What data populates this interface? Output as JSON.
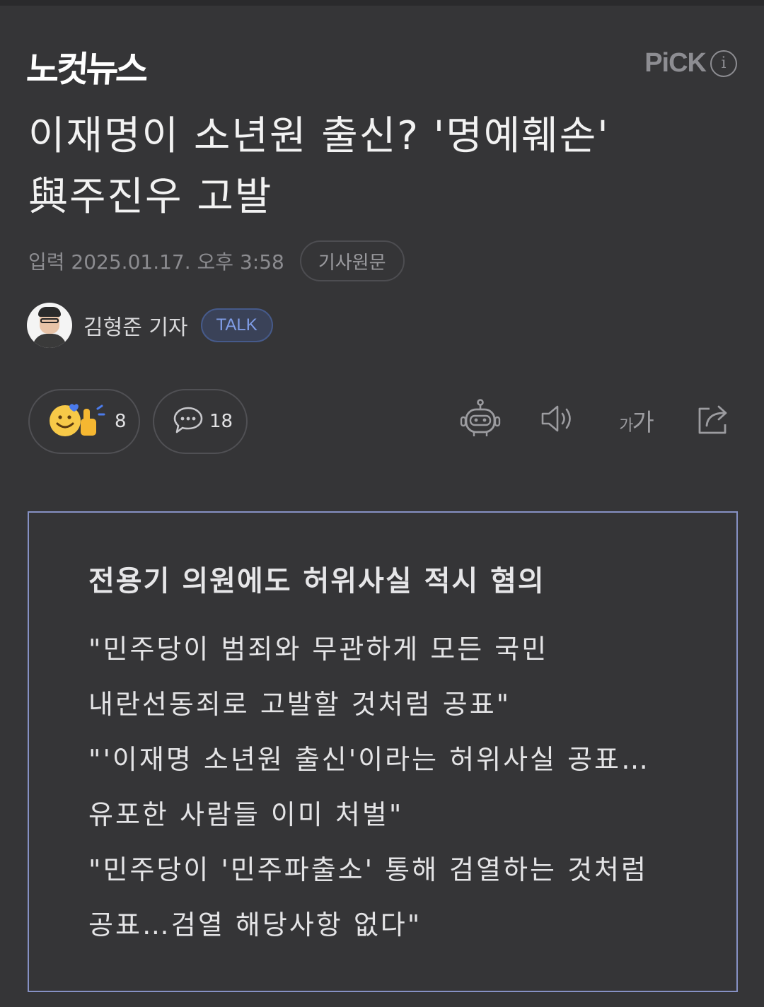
{
  "brand": {
    "logo_text": "노컷뉴스",
    "pick_label": "PiCK",
    "info_glyph": "i"
  },
  "article": {
    "headline": "이재명이 소년원 출신? '명예훼손' 與주진우 고발",
    "date_text": "입력 2025.01.17. 오후 3:58",
    "original_button": "기사원문",
    "author_name": "김형준 기자",
    "talk_label": "TALK"
  },
  "actions": {
    "reaction_count": "8",
    "comment_count": "18",
    "fontsize_small": "가",
    "fontsize_large": "가",
    "icons": [
      "reaction-emoji-icon",
      "comment-icon",
      "robot-summary-icon",
      "speaker-icon",
      "font-size-icon",
      "share-icon"
    ]
  },
  "summary": {
    "title": "전용기 의원에도 허위사실 적시 혐의",
    "items": [
      "\"민주당이 범죄와 무관하게 모든 국민 내란선동죄로 고발할 것처럼 공표\"",
      "\"'이재명 소년원 출신'이라는 허위사실 공표…유포한 사람들 이미 처벌\"",
      "\"민주당이 '민주파출소' 통해 검열하는 것처럼 공표…검열 해당사항 없다\""
    ]
  },
  "colors": {
    "background": "#353537",
    "summary_border": "#8691c4",
    "talk_text": "#7f9ce6"
  }
}
